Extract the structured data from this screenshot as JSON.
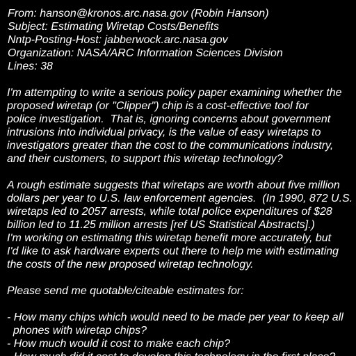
{
  "colors": {
    "background": "#000000",
    "text": "#ffffff"
  },
  "header": {
    "from": "From: hanson@kronos.arc.nasa.gov (Robin Hanson)",
    "subject": "Subject: Estimating Wiretap Costs/Benefits",
    "posting_host": "Nntp-Posting-Host: jabberwock.arc.nasa.gov",
    "organization": "Organization: NASA/ARC Information Sciences Division",
    "lines": "Lines: 38"
  },
  "body": {
    "paragraph1": [
      "I'm attempting to write a serious policy paper examining whether the",
      "proposed wiretap (or \"Clipper\") chip is a cost-effective tool for",
      "police investigation.  That is, ignoring concerns about government",
      "intrusions into individual privacy, is the value of easy wiretaps to",
      "investigators greater than the cost to the communications industry,",
      "and their customers, to support this wiretap technology?"
    ],
    "paragraph2": [
      "A rough estimate suggests that wiretaps are worth about five million",
      "dollars per year to U.S. law enforcement agencies.  (In 1990, 872 U.S.",
      "wiretaps led to 2057 arrests, while total police expenditures of $28",
      "billion led to 11.25 million arrests [ref US Statistical Abstracts].)",
      "I'm working on estimating this wiretap benefit more accurately, but",
      "I'd like to ask hardware experts out there to help me with estimating",
      "the costs of the new proposed wiretap technology."
    ],
    "paragraph3": [
      "Please send me quotable/citeable estimates for:"
    ],
    "list": [
      "- How many chips which would need to be made per year to keep all",
      "  phones with wiretap chips?",
      "- How much would it cost to make each chip?",
      "- How much did it cost to develop this technology in the first place?"
    ]
  }
}
